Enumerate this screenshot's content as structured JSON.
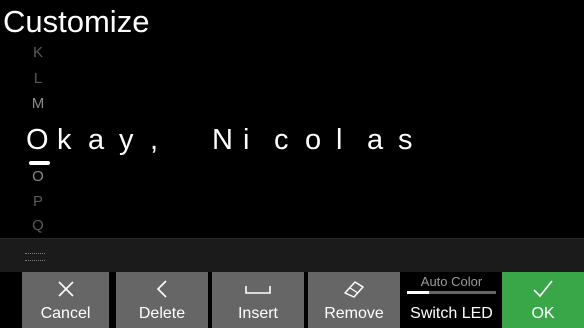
{
  "screen": {
    "title": "Customize"
  },
  "char_wheel": {
    "above": [
      "K",
      "L",
      "M"
    ],
    "below": [
      "O",
      "P",
      "Q"
    ]
  },
  "name_chars": [
    "O",
    "k",
    "a",
    "y",
    ",",
    " ",
    "N",
    "i",
    "c",
    "o",
    "l",
    "a",
    "s"
  ],
  "colors": {
    "ok_green": "#39a748",
    "button_gray": "#666666",
    "background": "#000000"
  },
  "buttons": [
    {
      "label": "Cancel",
      "icon": "close-icon"
    },
    {
      "label": "Delete",
      "icon": "chevron-left-icon"
    },
    {
      "label": "Insert",
      "icon": "space-icon"
    },
    {
      "label": "Remove",
      "icon": "eraser-icon"
    }
  ],
  "switch_led": {
    "label": "Switch LED",
    "mode": "Auto Color"
  },
  "ok_button": {
    "label": "OK",
    "icon": "check-icon"
  },
  "keyboard_toggle": {
    "icon": "keyboard-icon"
  }
}
